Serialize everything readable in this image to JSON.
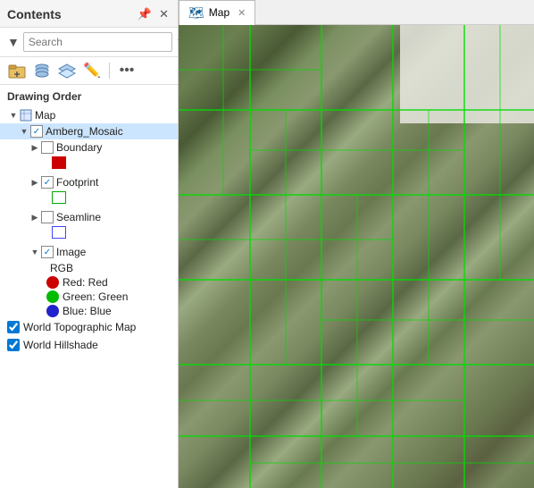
{
  "panel": {
    "title": "Contents",
    "search_placeholder": "Search",
    "drawing_order_label": "Drawing Order"
  },
  "toolbar": {
    "icons": [
      "folder",
      "cylinder",
      "layers",
      "pencil",
      "more"
    ]
  },
  "tree": {
    "map_label": "Map",
    "amberg_mosaic": "Amberg_Mosaic",
    "boundary": "Boundary",
    "footprint": "Footprint",
    "seamline": "Seamline",
    "image": "Image",
    "rgb_label": "RGB",
    "red_label": "Red:  Red",
    "green_label": "Green: Green",
    "blue_label": "Blue:  Blue",
    "world_topo": "World Topographic Map",
    "world_hillshade": "World Hillshade"
  },
  "map_tab": {
    "label": "Map",
    "close": "✕"
  },
  "colors": {
    "boundary_swatch": "#cc0000",
    "footprint_swatch": "#00cc00",
    "seamline_swatch": "#4444ff",
    "grid_line": "#00cc00",
    "selection_bg": "#cce5ff"
  }
}
